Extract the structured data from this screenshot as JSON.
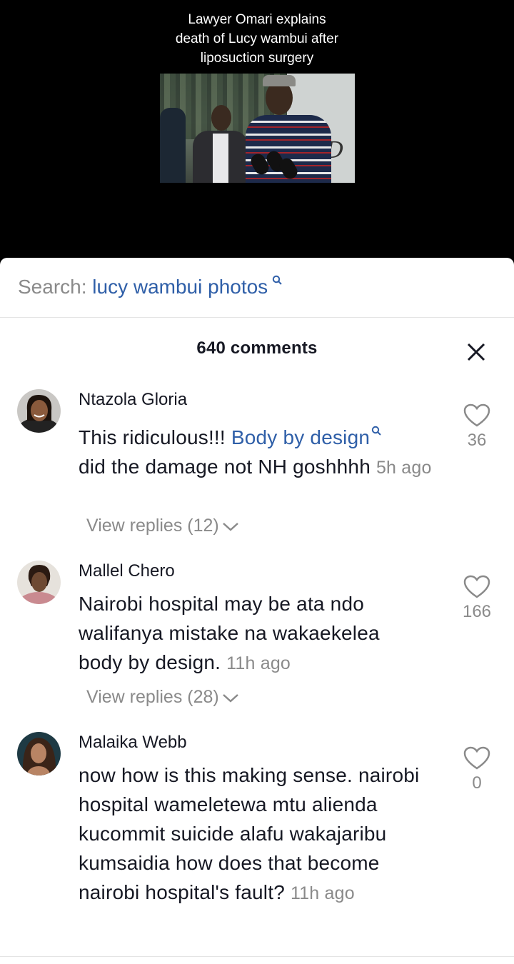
{
  "video": {
    "caption_lines": [
      "Lawyer Omari explains",
      "death of  Lucy wambui after",
      "liposuction surgery"
    ]
  },
  "search": {
    "prefix": "Search: ",
    "query": "lucy wambui photos",
    "icon": "search-icon"
  },
  "comments_header": {
    "count_label": "640 comments",
    "close_icon": "close-icon"
  },
  "comments": [
    {
      "user": "Ntazola Gloria",
      "text_before_link": "This ridiculous!!! ",
      "link_text": "Body by design",
      "text_after_link": "did the damage not NH goshhhh ",
      "time": "5h ago",
      "replies_label": "View replies (12)",
      "likes": "36"
    },
    {
      "user": "Mallel Chero",
      "text": "Nairobi hospital may be ata ndo walifanya mistake na wakaekelea body by design. ",
      "time": "11h ago",
      "replies_label": "View replies (28)",
      "likes": "166"
    },
    {
      "user": "Malaika Webb",
      "text": "now how is this making sense. nairobi hospital wameletewa mtu alienda kucommit suicide alafu wakajaribu kumsaidia how does that become nairobi hospital's fault? ",
      "time": "11h ago",
      "likes": "0"
    }
  ],
  "colors": {
    "link": "#2f5fa8",
    "muted": "#8a8a8a",
    "text": "#161823"
  }
}
